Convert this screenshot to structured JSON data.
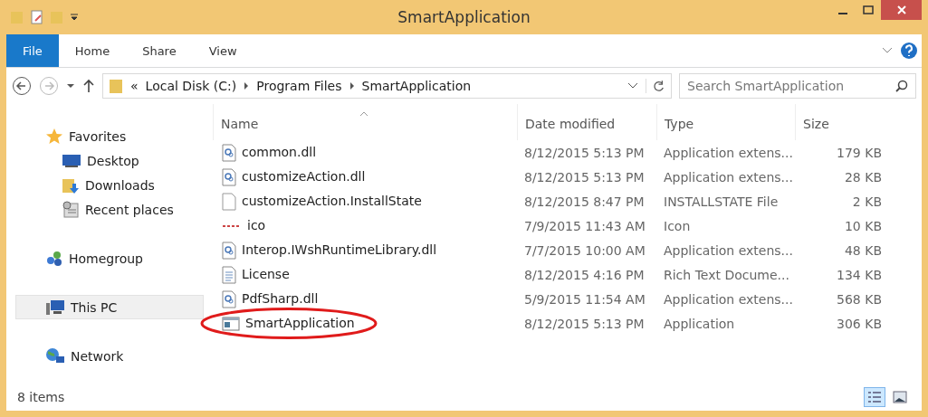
{
  "window": {
    "title": "SmartApplication"
  },
  "ribbon": {
    "tabs": [
      {
        "label": "File",
        "selected": true
      },
      {
        "label": "Home",
        "selected": false
      },
      {
        "label": "Share",
        "selected": false
      },
      {
        "label": "View",
        "selected": false
      }
    ]
  },
  "address": {
    "path": [
      {
        "label": "«"
      },
      {
        "label": "Local Disk (C:)"
      },
      {
        "label": "Program Files"
      },
      {
        "label": "SmartApplication"
      }
    ],
    "search_placeholder": "Search SmartApplication"
  },
  "sidebar": {
    "groups": [
      {
        "label": "Favorites",
        "kind": "star",
        "selected": false,
        "children": [
          {
            "label": "Desktop",
            "kind": "desktop",
            "selected": false
          },
          {
            "label": "Downloads",
            "kind": "downloads",
            "selected": false
          },
          {
            "label": "Recent places",
            "kind": "recent",
            "selected": false
          }
        ]
      },
      {
        "label": "Homegroup",
        "kind": "homegroup",
        "selected": false
      },
      {
        "label": "This PC",
        "kind": "pc",
        "selected": true
      },
      {
        "label": "Network",
        "kind": "network",
        "selected": false
      }
    ]
  },
  "table": {
    "columns": [
      "Name",
      "Date modified",
      "Type",
      "Size"
    ],
    "rows": [
      {
        "name": "common.dll",
        "kind": "dll",
        "date": "8/12/2015 5:13 PM",
        "type": "Application extens...",
        "size": "179 KB",
        "circled": false
      },
      {
        "name": "customizeAction.dll",
        "kind": "dll",
        "date": "8/12/2015 5:13 PM",
        "type": "Application extens...",
        "size": "28 KB",
        "circled": false
      },
      {
        "name": "customizeAction.InstallState",
        "kind": "blank",
        "date": "8/12/2015 8:47 PM",
        "type": "INSTALLSTATE File",
        "size": "2 KB",
        "circled": false
      },
      {
        "name": "ico",
        "kind": "ico",
        "date": "7/9/2015 11:43 AM",
        "type": "Icon",
        "size": "10 KB",
        "circled": false
      },
      {
        "name": "Interop.IWshRuntimeLibrary.dll",
        "kind": "dll",
        "date": "7/7/2015 10:00 AM",
        "type": "Application extens...",
        "size": "48 KB",
        "circled": false
      },
      {
        "name": "License",
        "kind": "doc",
        "date": "8/12/2015 4:16 PM",
        "type": "Rich Text Docume...",
        "size": "134 KB",
        "circled": false
      },
      {
        "name": "PdfSharp.dll",
        "kind": "dll",
        "date": "5/9/2015 11:54 AM",
        "type": "Application extens...",
        "size": "568 KB",
        "circled": false
      },
      {
        "name": "SmartApplication",
        "kind": "app",
        "date": "8/12/2015 5:13 PM",
        "type": "Application",
        "size": "306 KB",
        "circled": true
      }
    ]
  },
  "status_bar": {
    "count": "8 items",
    "views": [
      {
        "kind": "details",
        "selected": true
      },
      {
        "kind": "large",
        "selected": false
      }
    ]
  }
}
